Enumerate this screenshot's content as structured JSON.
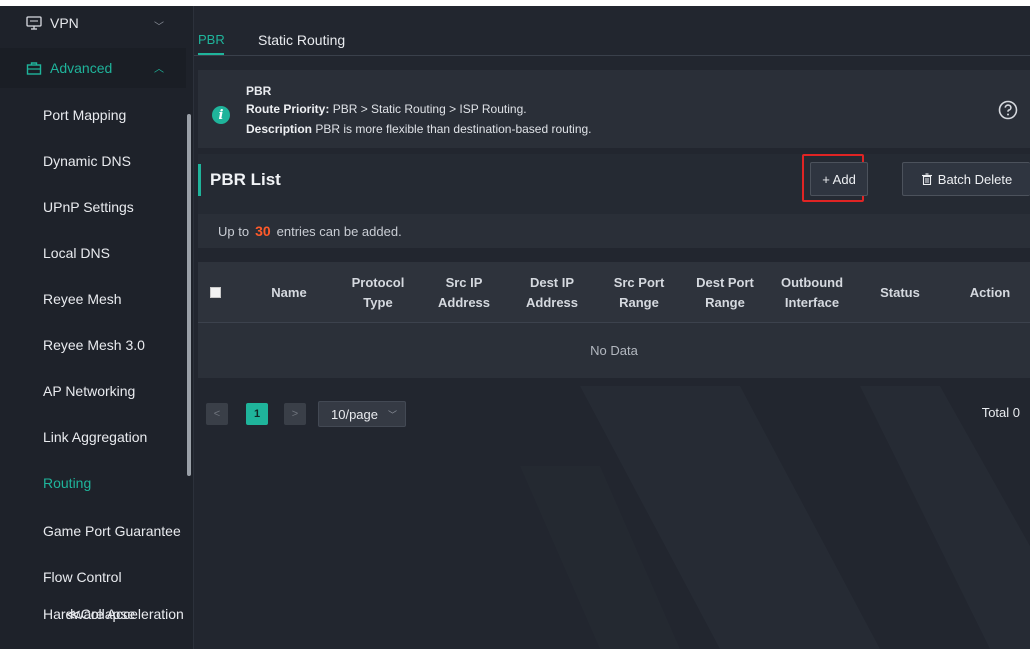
{
  "sidebar": {
    "vpn_label": "VPN",
    "advanced_label": "Advanced",
    "items": [
      {
        "label": "Port Mapping"
      },
      {
        "label": "Dynamic DNS"
      },
      {
        "label": "UPnP Settings"
      },
      {
        "label": "Local DNS"
      },
      {
        "label": "Reyee Mesh"
      },
      {
        "label": "Reyee Mesh 3.0"
      },
      {
        "label": "AP Networking"
      },
      {
        "label": "Link Aggregation"
      },
      {
        "label": "Routing",
        "active": true
      },
      {
        "label": "Game Port Guarantee"
      },
      {
        "label": "Flow Control"
      },
      {
        "label": "Hardware Acceleration"
      }
    ],
    "collapse_label": "≪Collapse"
  },
  "tabs": [
    {
      "label": "PBR",
      "active": true
    },
    {
      "label": "Static Routing"
    }
  ],
  "info": {
    "title": "PBR",
    "priority_key": "Route Priority:",
    "priority_value": "PBR > Static Routing > ISP Routing.",
    "description_key": "Description",
    "description_value": "PBR is more flexible than destination-based routing."
  },
  "list": {
    "title": "PBR List",
    "add_label": "+ Add",
    "batch_delete_label": "Batch Delete",
    "entries_prefix": "Up to",
    "entries_count": "30",
    "entries_suffix": "entries can be added."
  },
  "table": {
    "columns": [
      {
        "l1": "Name"
      },
      {
        "l1": "Protocol",
        "l2": "Type"
      },
      {
        "l1": "Src IP",
        "l2": "Address"
      },
      {
        "l1": "Dest IP",
        "l2": "Address"
      },
      {
        "l1": "Src Port",
        "l2": "Range"
      },
      {
        "l1": "Dest Port",
        "l2": "Range"
      },
      {
        "l1": "Outbound",
        "l2": "Interface"
      },
      {
        "l1": "Status"
      },
      {
        "l1": "Action"
      }
    ],
    "empty_text": "No Data"
  },
  "pagination": {
    "prev": "<",
    "current_page": "1",
    "next": ">",
    "page_size": "10/page",
    "total": "Total 0"
  },
  "colors": {
    "accent": "#1fb49b",
    "highlight": "#e02424",
    "entries_count": "#ff5a2a"
  }
}
